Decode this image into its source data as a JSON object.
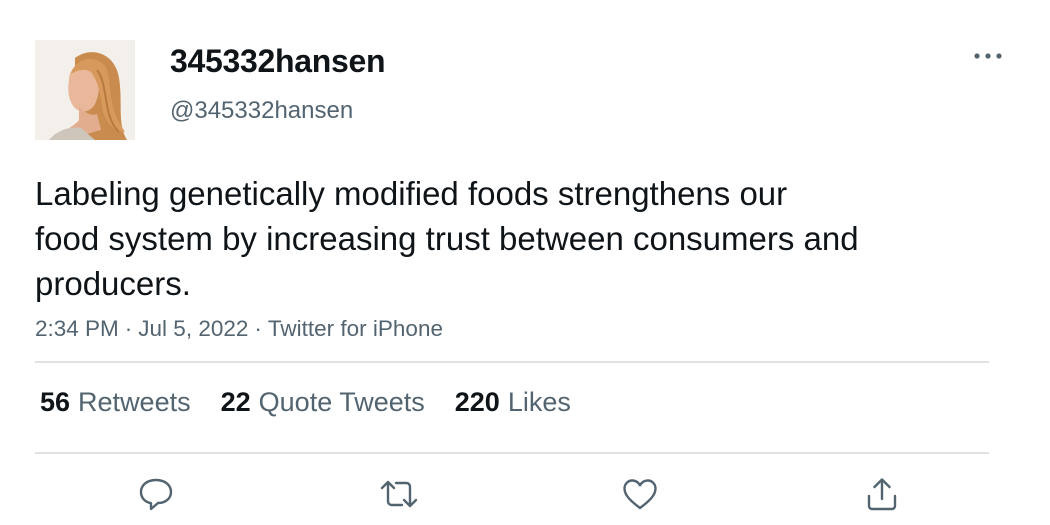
{
  "author": {
    "display_name": "345332hansen",
    "handle": "@345332hansen",
    "avatar_icon": "profile-photo"
  },
  "tweet": {
    "text_lines": [
      "Labeling genetically modified foods strengthens our",
      "food system by increasing trust between consumers and",
      "producers."
    ],
    "time": "2:34 PM",
    "date": "Jul 5, 2022",
    "source": "Twitter for iPhone",
    "separator": "·"
  },
  "stats": {
    "retweets": {
      "count": "56",
      "label": "Retweets"
    },
    "quotes": {
      "count": "22",
      "label": "Quote Tweets"
    },
    "likes": {
      "count": "220",
      "label": "Likes"
    }
  },
  "actions": [
    "reply-icon",
    "retweet-icon",
    "like-icon",
    "share-icon"
  ],
  "colors": {
    "text": "#0f1419",
    "secondary": "#536471",
    "divider": "#dfe3e6"
  }
}
